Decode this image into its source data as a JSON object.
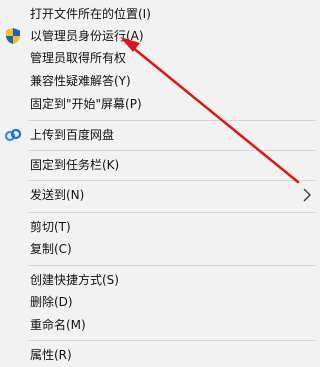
{
  "menu": {
    "items": [
      {
        "label": "打开文件所在的位置(I)"
      },
      {
        "label": "以管理员身份运行(A)",
        "icon": "uac-shield-icon"
      },
      {
        "label": "管理员取得所有权"
      },
      {
        "label": "兼容性疑难解答(Y)"
      },
      {
        "label": "固定到\"开始\"屏幕(P)"
      },
      {
        "label": "上传到百度网盘",
        "icon": "baidu-netdisk-icon"
      },
      {
        "label": "固定到任务栏(K)"
      },
      {
        "label": "发送到(N)",
        "submenu": true
      },
      {
        "label": "剪切(T)"
      },
      {
        "label": "复制(C)"
      },
      {
        "label": "创建快捷方式(S)"
      },
      {
        "label": "删除(D)"
      },
      {
        "label": "重命名(M)"
      },
      {
        "label": "属性(R)"
      }
    ]
  },
  "colors": {
    "menu_bg": "#f2f2f2",
    "separator": "#d6d6d6",
    "annotation_arrow": "#e01515",
    "uac_blue": "#1e5fc7",
    "uac_yellow": "#f2c21b"
  }
}
